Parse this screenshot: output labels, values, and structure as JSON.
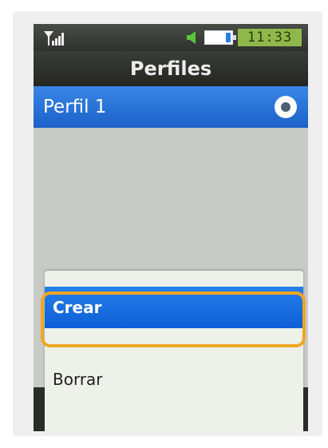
{
  "status_bar": {
    "signal_icon": "signal-bars-icon",
    "sound_icon": "speaker-icon",
    "battery_icon": "battery-icon",
    "battery_level": 0.2,
    "time": "11:33"
  },
  "header": {
    "title": "Perfiles"
  },
  "profile": {
    "label": "Perfil 1",
    "selected_icon": "radio-selected-icon"
  },
  "context_menu": {
    "items": [
      {
        "label": "Crear",
        "highlighted": true
      },
      {
        "label": "Borrar",
        "highlighted": false
      }
    ],
    "highlight_color": "#f2a623"
  },
  "colors": {
    "selection_blue": "#1b61c9",
    "title_bar": "#2f312d",
    "clock_bg": "#8fb84a"
  }
}
